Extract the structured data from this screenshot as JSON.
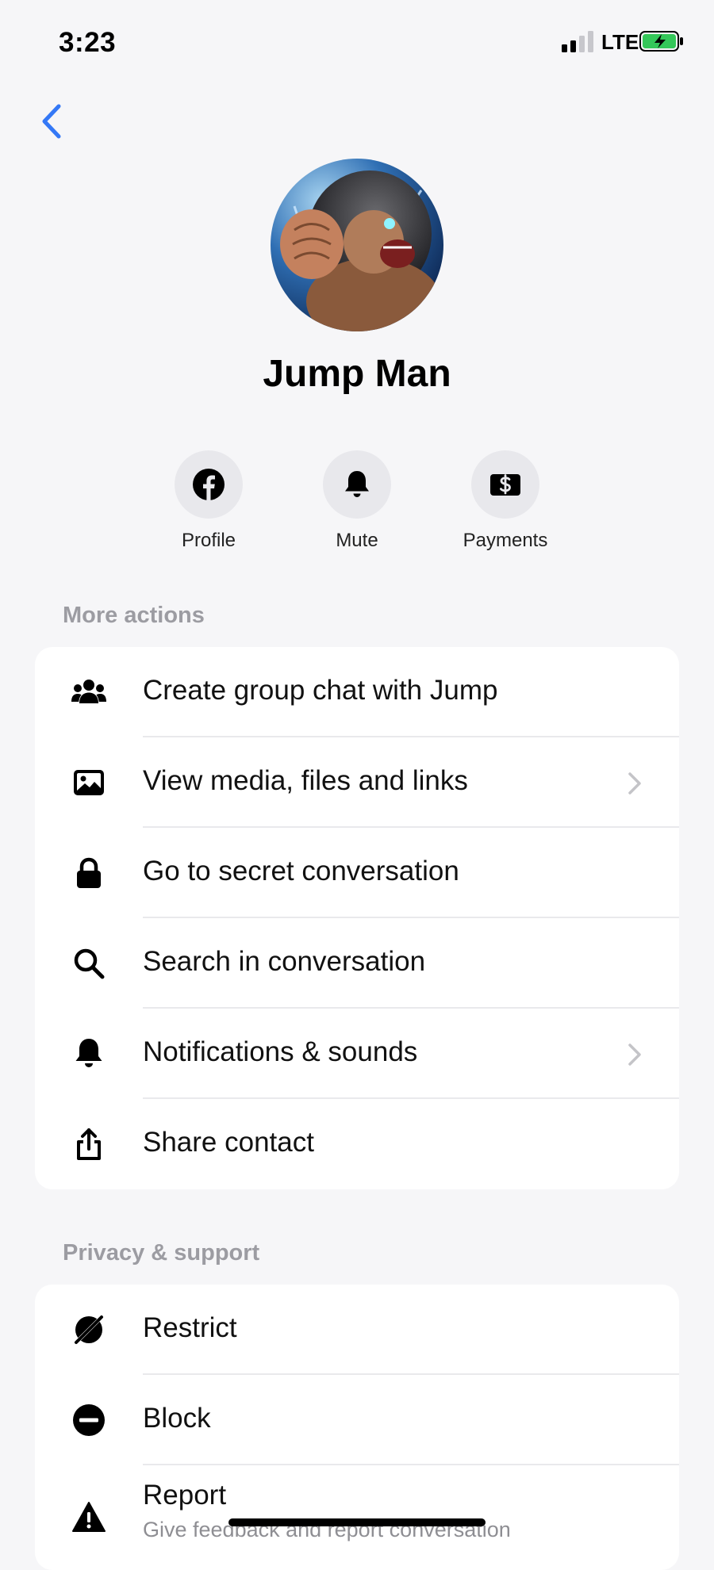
{
  "status_bar": {
    "time": "3:23",
    "network": "LTE"
  },
  "profile": {
    "name": "Jump Man"
  },
  "quick_actions": [
    {
      "label": "Profile",
      "icon": "facebook-icon"
    },
    {
      "label": "Mute",
      "icon": "bell-icon"
    },
    {
      "label": "Payments",
      "icon": "payments-icon"
    }
  ],
  "more_actions": {
    "title": "More actions",
    "items": [
      {
        "label": "Create group chat with Jump",
        "icon": "people-icon"
      },
      {
        "label": "View media, files and links",
        "icon": "image-icon",
        "chevron": true
      },
      {
        "label": "Go to secret conversation",
        "icon": "lock-icon"
      },
      {
        "label": "Search in conversation",
        "icon": "search-icon"
      },
      {
        "label": "Notifications & sounds",
        "icon": "bell-icon",
        "chevron": true
      },
      {
        "label": "Share contact",
        "icon": "share-icon"
      }
    ]
  },
  "privacy_support": {
    "title": "Privacy & support",
    "items": [
      {
        "label": "Restrict",
        "icon": "restrict-icon"
      },
      {
        "label": "Block",
        "icon": "block-icon"
      },
      {
        "label": "Report",
        "sublabel": "Give feedback and report conversation",
        "icon": "warning-icon"
      }
    ]
  },
  "colors": {
    "accent": "#3478f6",
    "background": "#f6f6f8",
    "card": "#ffffff",
    "section_title": "#9c9ca2"
  }
}
